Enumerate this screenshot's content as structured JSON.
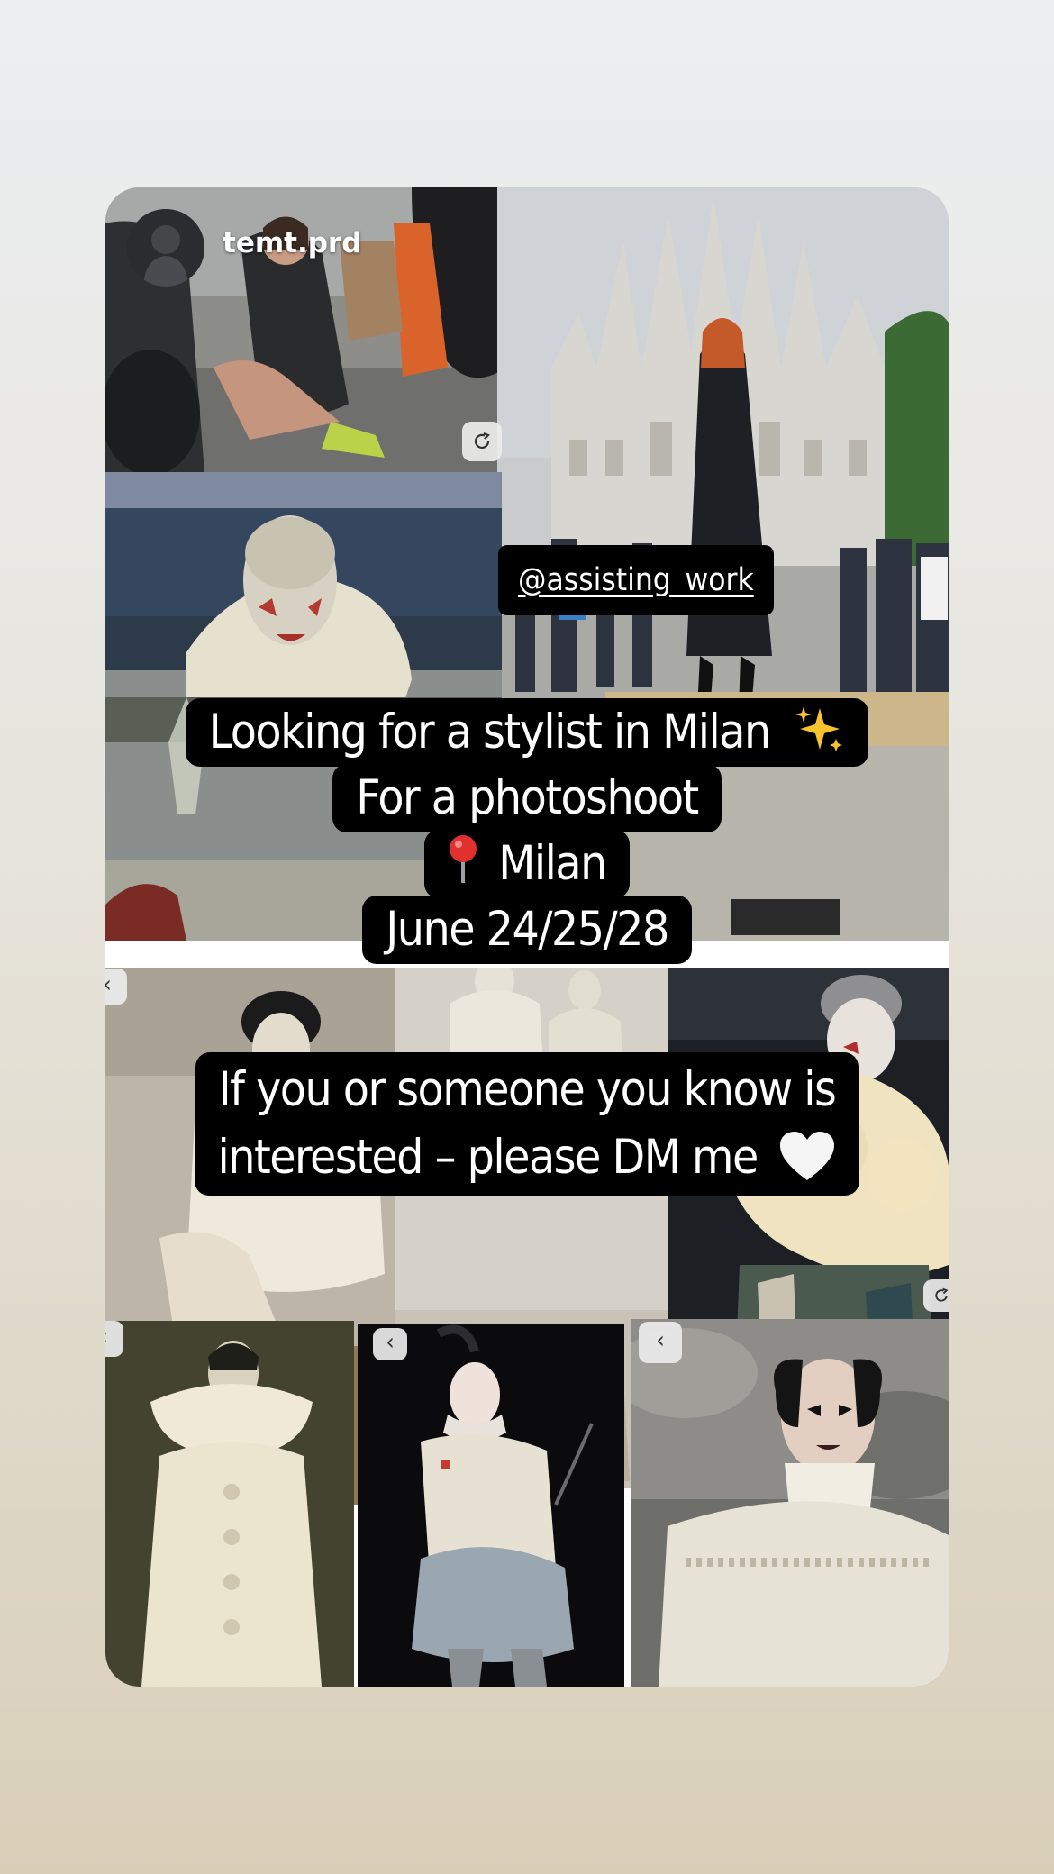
{
  "story": {
    "username": "temt.prd",
    "mention": "@assisting_work",
    "caption_lines": [
      "Looking for a stylist in Milan",
      "For a photoshoot",
      "Milan",
      "June 24/25/28"
    ],
    "second_caption_lines": [
      "If you or someone you know is",
      "interested – please DM me"
    ],
    "icons": {
      "line1_end": "sparkles-icon",
      "line3_start": "round-pushpin-icon",
      "second_end": "white-heart-icon",
      "tile_nav": "chevron-left-icon",
      "tile_refresh": "refresh-icon"
    }
  },
  "colors": {
    "caption_bg": "#000000",
    "caption_text": "#ffffff",
    "pin_red": "#e0312f",
    "sparkle_yellow": "#f7c52b"
  }
}
